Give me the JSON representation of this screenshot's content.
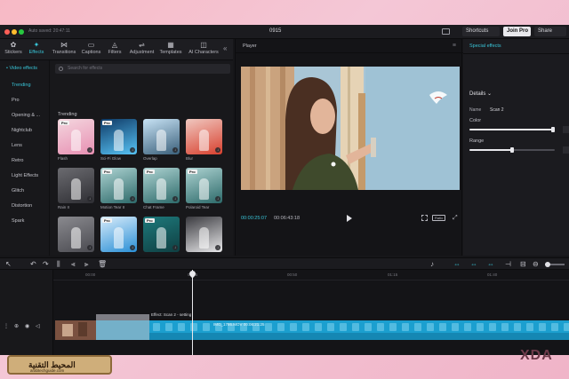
{
  "titlebar": {
    "save_state": "Auto saved: 20:47:11",
    "project_title": "0915",
    "shortcuts_label": "Shortcuts",
    "join_pro_label": "Join Pro",
    "share_label": "Share"
  },
  "tools": [
    {
      "name": "stickers",
      "label": "Stickers",
      "icon": "✿"
    },
    {
      "name": "effects",
      "label": "Effects",
      "icon": "✦",
      "active": true
    },
    {
      "name": "transitions",
      "label": "Transitions",
      "icon": "⋈"
    },
    {
      "name": "captions",
      "label": "Captions",
      "icon": "▭"
    },
    {
      "name": "filters",
      "label": "Filters",
      "icon": "◬"
    },
    {
      "name": "adjustment",
      "label": "Adjustment",
      "icon": "⇌"
    },
    {
      "name": "templates",
      "label": "Templates",
      "icon": "▦"
    },
    {
      "name": "ai-characters",
      "label": "AI Characters",
      "icon": "◫"
    }
  ],
  "categories": {
    "header": "• Video effects",
    "items": [
      "Trending",
      "Pro",
      "Opening & ...",
      "Nightclub",
      "Lens",
      "Retro",
      "Light Effects",
      "Glitch",
      "Distortion",
      "Spark"
    ],
    "active_index": 0
  },
  "effects_panel": {
    "search_placeholder": "Search for effects",
    "section_label": "Trending",
    "thumbnails": [
      {
        "label": "Flash",
        "pro": true,
        "palette": "pink"
      },
      {
        "label": "Sci-Fi Glow",
        "pro": true,
        "palette": "blue"
      },
      {
        "label": "Overlap",
        "pro": false,
        "palette": "sky"
      },
      {
        "label": "Blur",
        "pro": false,
        "palette": "red"
      },
      {
        "label": "Rain II",
        "pro": false,
        "palette": "grey"
      },
      {
        "label": "Motion Tear II",
        "pro": true,
        "palette": "teal"
      },
      {
        "label": "Chat Frame",
        "pro": true,
        "palette": "teal"
      },
      {
        "label": "Polaroid Tear",
        "pro": true,
        "palette": "teal"
      },
      {
        "label": "",
        "pro": false,
        "palette": "fog"
      },
      {
        "label": "",
        "pro": true,
        "palette": "sky2"
      },
      {
        "label": "",
        "pro": true,
        "palette": "teal2"
      },
      {
        "label": "",
        "pro": false,
        "palette": "dark"
      }
    ]
  },
  "player": {
    "title": "Player",
    "current_time": "00:00:25:07",
    "duration": "00:06:43:18",
    "ratio_label": "Ratio"
  },
  "inspector": {
    "tab": "Special effects",
    "details_label": "Details ⌄",
    "name_key": "Name",
    "name_value": "Scan 2",
    "color_label": "Color",
    "range_label": "Range",
    "color_level": 0.98,
    "range_level": 0.5
  },
  "timeline": {
    "ruler_ticks": [
      "00:00",
      "00:25",
      "00:50",
      "01:15",
      "01:40"
    ],
    "effect_clip_label": "Effect: Scan 2 - setting",
    "video_clip_label": "IMG_1786.MOV   00:06:21:25"
  },
  "watermarks": {
    "left_text": "المحيط التقنية",
    "left_sub": "arabtechguide.com",
    "right_text": "XDA"
  },
  "colors": {
    "accent": "#39c5d8",
    "clip": "#1b9fcf",
    "panel": "#18181b",
    "background": "#161619"
  }
}
